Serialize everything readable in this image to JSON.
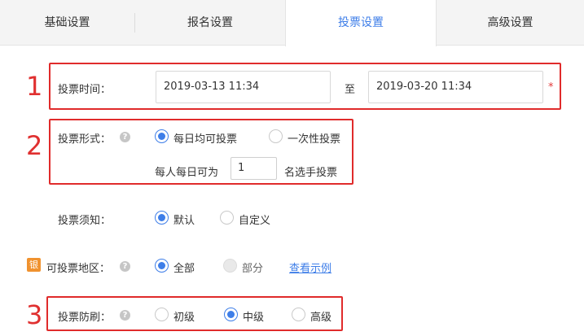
{
  "tabs": [
    {
      "label": "基础设置"
    },
    {
      "label": "报名设置"
    },
    {
      "label": "投票设置"
    },
    {
      "label": "高级设置"
    }
  ],
  "annotations": [
    "1",
    "2",
    "3"
  ],
  "vote_time": {
    "label": "投票时间：",
    "start": "2019-03-13 11:34",
    "separator": "至",
    "end": "2019-03-20 11:34",
    "required_mark": "*"
  },
  "vote_form": {
    "label": "投票形式：",
    "options": [
      "每日均可投票",
      "一次性投票"
    ],
    "daily_prefix": "每人每日可为",
    "daily_value": "1",
    "daily_suffix": "名选手投票"
  },
  "vote_notice": {
    "label": "投票须知：",
    "options": [
      "默认",
      "自定义"
    ]
  },
  "vote_region": {
    "badge": "银",
    "label": "可投票地区：",
    "options": [
      "全部",
      "部分"
    ],
    "example_link": "查看示例"
  },
  "anti_fraud": {
    "label": "投票防刷：",
    "options": [
      "初级",
      "中级",
      "高级"
    ]
  },
  "help_glyph": "?",
  "colors": {
    "accent": "#3e7ee8",
    "annotation_red": "#e02b2b",
    "badge_orange": "#f0922f",
    "tab_bg": "#f4f4f4"
  }
}
